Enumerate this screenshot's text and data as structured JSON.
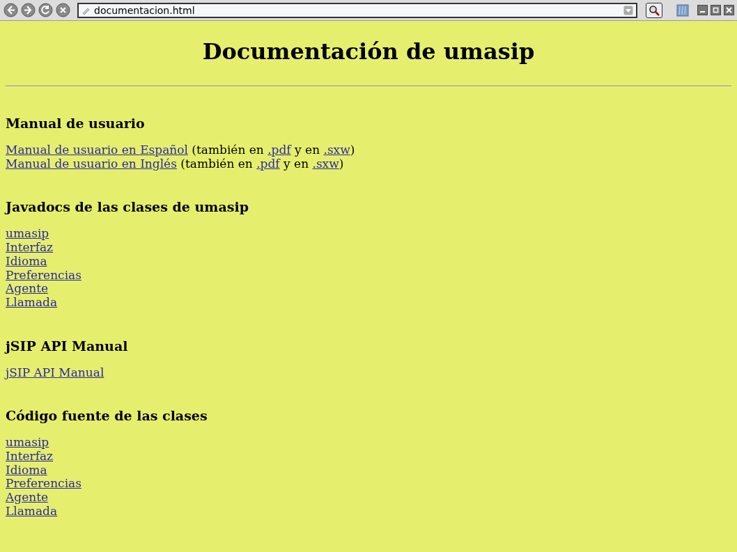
{
  "toolbar": {
    "address": "documentacion.html"
  },
  "title": "Documentación de umasip",
  "sections": [
    {
      "heading": "Manual de usuario",
      "items": [
        {
          "parts": [
            {
              "text": "Manual de usuario en Español",
              "link": true
            },
            {
              "text": " (también en ",
              "link": false
            },
            {
              "text": ".pdf",
              "link": true
            },
            {
              "text": " y en ",
              "link": false
            },
            {
              "text": ".sxw",
              "link": true
            },
            {
              "text": ")",
              "link": false
            }
          ]
        },
        {
          "parts": [
            {
              "text": "Manual de usuario en Inglés",
              "link": true
            },
            {
              "text": " (también en ",
              "link": false
            },
            {
              "text": ".pdf",
              "link": true
            },
            {
              "text": " y en ",
              "link": false
            },
            {
              "text": ".sxw",
              "link": true
            },
            {
              "text": ")",
              "link": false
            }
          ]
        }
      ]
    },
    {
      "heading": "Javadocs de las clases de umasip",
      "items": [
        {
          "parts": [
            {
              "text": "umasip",
              "link": true
            }
          ]
        },
        {
          "parts": [
            {
              "text": "Interfaz",
              "link": true
            }
          ]
        },
        {
          "parts": [
            {
              "text": "Idioma",
              "link": true
            }
          ]
        },
        {
          "parts": [
            {
              "text": "Preferencias",
              "link": true
            }
          ]
        },
        {
          "parts": [
            {
              "text": "Agente",
              "link": true
            }
          ]
        },
        {
          "parts": [
            {
              "text": "Llamada",
              "link": true
            }
          ]
        }
      ]
    },
    {
      "heading": "jSIP API Manual",
      "items": [
        {
          "parts": [
            {
              "text": "jSIP API Manual",
              "link": true
            }
          ]
        }
      ]
    },
    {
      "heading": "Código fuente de las clases",
      "items": [
        {
          "parts": [
            {
              "text": "umasip",
              "link": true
            }
          ]
        },
        {
          "parts": [
            {
              "text": "Interfaz",
              "link": true
            }
          ]
        },
        {
          "parts": [
            {
              "text": "Idioma",
              "link": true
            }
          ]
        },
        {
          "parts": [
            {
              "text": "Preferencias",
              "link": true
            }
          ]
        },
        {
          "parts": [
            {
              "text": "Agente",
              "link": true
            }
          ]
        },
        {
          "parts": [
            {
              "text": "Llamada",
              "link": true
            }
          ]
        }
      ]
    }
  ]
}
